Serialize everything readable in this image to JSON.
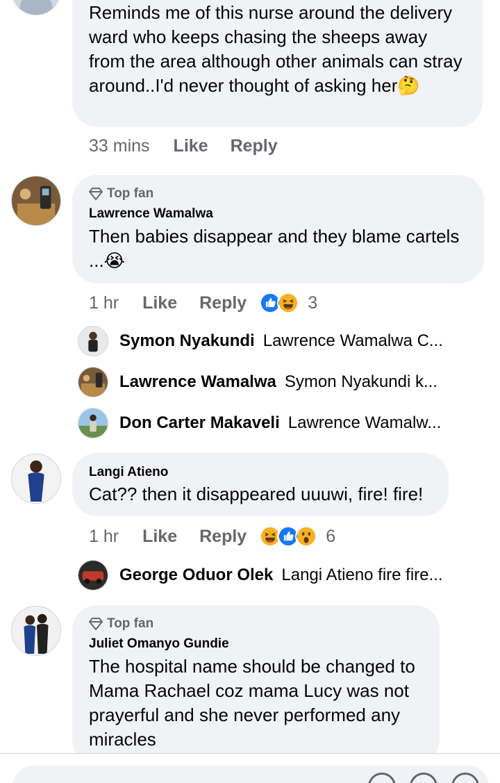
{
  "comment0": {
    "text": "Reminds me of this nurse  around the delivery ward who keeps chasing the sheeps away from the area although other animals can stray around..I'd never thought of asking her🤔",
    "time": "33 mins",
    "like": "Like",
    "reply": "Reply"
  },
  "comment1": {
    "badge": "Top fan",
    "author": "Lawrence Wamalwa",
    "text": "Then babies disappear and they blame cartels ...😭",
    "time": "1 hr",
    "like": "Like",
    "reply": "Reply",
    "reactions": [
      "like-reaction",
      "haha-reaction"
    ],
    "reaction_count": "3",
    "replies": [
      {
        "name": "Symon Nyakundi",
        "text": "Lawrence Wamalwa C..."
      },
      {
        "name": "Lawrence Wamalwa",
        "text": "Symon Nyakundi k..."
      },
      {
        "name": "Don Carter Makaveli",
        "text": "Lawrence Wamalw..."
      }
    ]
  },
  "comment2": {
    "author": "Langi Atieno",
    "text": "Cat??  then it disappeared uuuwi, fire! fire!",
    "time": "1 hr",
    "like": "Like",
    "reply": "Reply",
    "reactions": [
      "haha-reaction",
      "like-reaction",
      "wow-reaction"
    ],
    "reaction_count": "6",
    "replies": [
      {
        "name": "George Oduor Olek",
        "text": "Langi Atieno fire fire..."
      }
    ]
  },
  "comment3": {
    "badge": "Top fan",
    "author": "Juliet Omanyo Gundie",
    "text": "The hospital name should be changed to Mama Rachael coz mama Lucy was not prayerful and she never performed any miracles"
  },
  "colors": {
    "bubble": "#f0f2f5",
    "meta": "#65676b",
    "like_blue": "#1877f2",
    "haha_yellow": "#f7b125"
  }
}
